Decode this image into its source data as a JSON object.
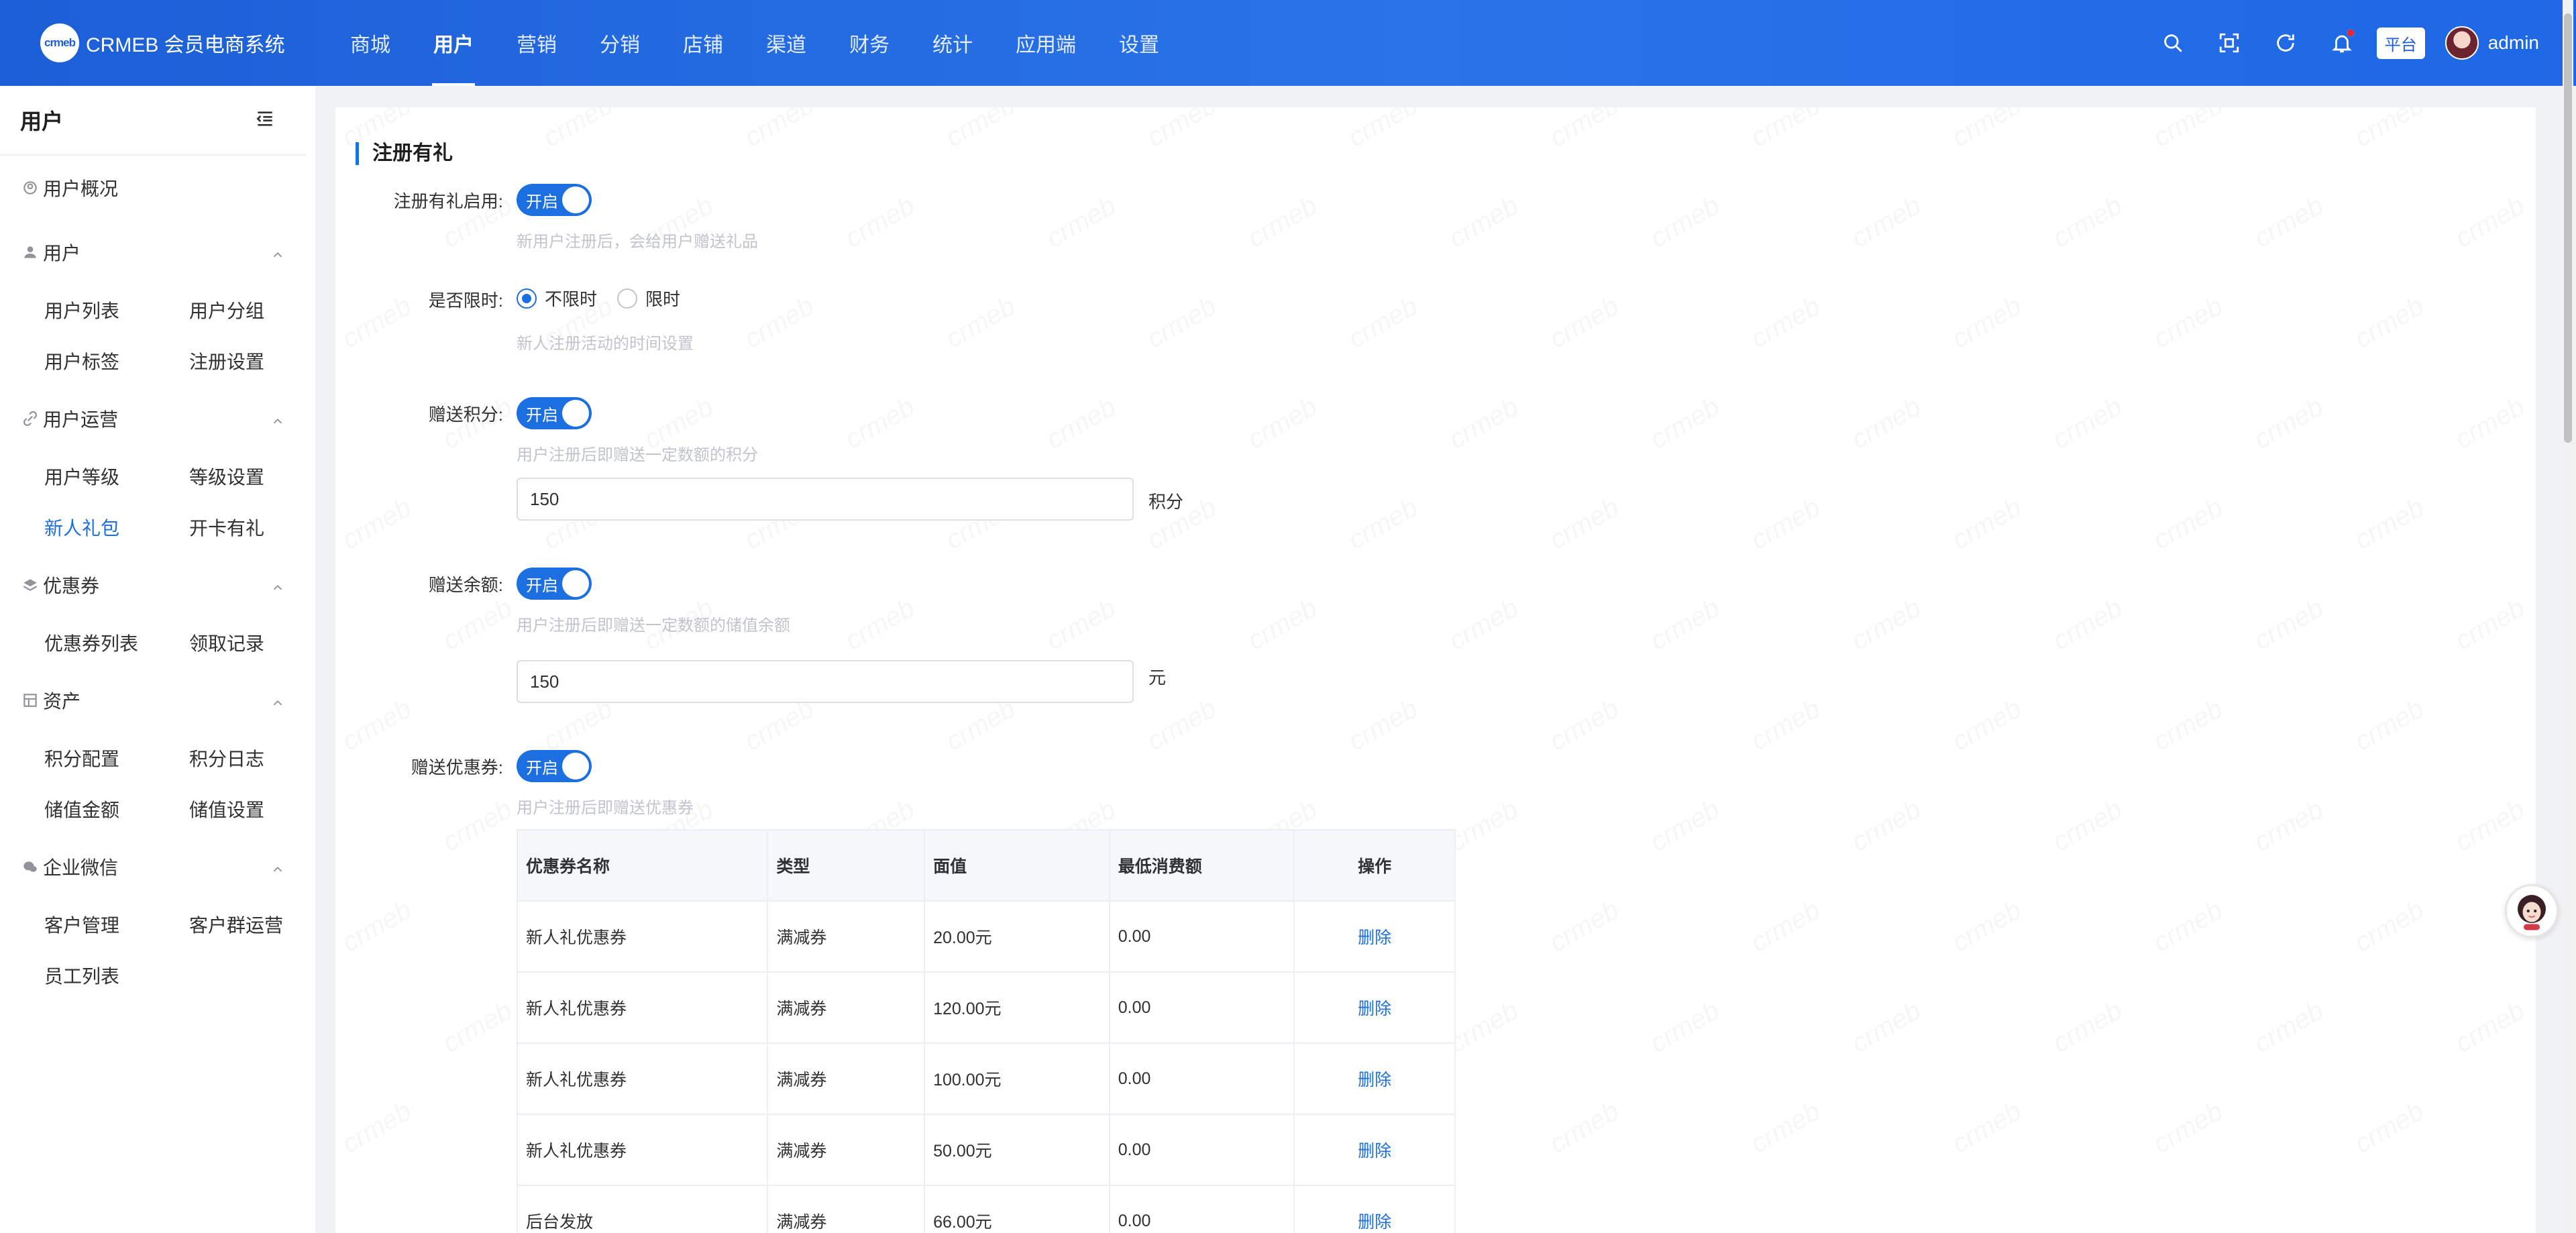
{
  "app": {
    "logo_mark": "crmeb",
    "name": "CRMEB 会员电商系统"
  },
  "nav": {
    "items": [
      "商城",
      "用户",
      "营销",
      "分销",
      "店铺",
      "渠道",
      "财务",
      "统计",
      "应用端",
      "设置"
    ],
    "active": "用户"
  },
  "topbar": {
    "platform_badge": "平台",
    "username": "admin"
  },
  "sidebar": {
    "title": "用户",
    "overview": "用户概况",
    "groups": [
      {
        "label": "用户",
        "items": [
          "用户列表",
          "用户分组",
          "用户标签",
          "注册设置"
        ]
      },
      {
        "label": "用户运营",
        "items": [
          "用户等级",
          "等级设置",
          "新人礼包",
          "开卡有礼"
        ]
      },
      {
        "label": "优惠券",
        "items": [
          "优惠券列表",
          "领取记录"
        ]
      },
      {
        "label": "资产",
        "items": [
          "积分配置",
          "积分日志",
          "储值金额",
          "储值设置"
        ]
      },
      {
        "label": "企业微信",
        "items": [
          "客户管理",
          "客户群运营",
          "员工列表"
        ]
      }
    ],
    "active_item": "新人礼包"
  },
  "form": {
    "section_title": "注册有礼",
    "enable": {
      "label": "注册有礼启用:",
      "switch_text": "开启",
      "hint": "新用户注册后，会给用户赠送礼品"
    },
    "time_limit": {
      "label": "是否限时:",
      "options": [
        "不限时",
        "限时"
      ],
      "selected": "不限时",
      "hint": "新人注册活动的时间设置"
    },
    "points": {
      "label": "赠送积分:",
      "switch_text": "开启",
      "hint": "用户注册后即赠送一定数额的积分",
      "value": "150",
      "unit": "积分"
    },
    "balance": {
      "label": "赠送余额:",
      "switch_text": "开启",
      "hint": "用户注册后即赠送一定数额的储值余额",
      "value": "150",
      "unit": "元"
    },
    "coupon": {
      "label": "赠送优惠券:",
      "switch_text": "开启",
      "hint": "用户注册后即赠送优惠券"
    }
  },
  "coupon_table": {
    "headers": [
      "优惠券名称",
      "类型",
      "面值",
      "最低消费额",
      "操作"
    ],
    "rows": [
      {
        "name": "新人礼优惠券",
        "type": "满减券",
        "face": "20.00元",
        "min": "0.00",
        "action": "删除"
      },
      {
        "name": "新人礼优惠券",
        "type": "满减券",
        "face": "120.00元",
        "min": "0.00",
        "action": "删除"
      },
      {
        "name": "新人礼优惠券",
        "type": "满减券",
        "face": "100.00元",
        "min": "0.00",
        "action": "删除"
      },
      {
        "name": "新人礼优惠券",
        "type": "满减券",
        "face": "50.00元",
        "min": "0.00",
        "action": "删除"
      },
      {
        "name": "后台发放",
        "type": "满减券",
        "face": "66.00元",
        "min": "0.00",
        "action": "删除"
      }
    ]
  },
  "watermark": {
    "text": "crmeb"
  },
  "colors": {
    "primary": "#1c6fe0",
    "topbar": "#2a73e8"
  },
  "icons": [
    "search-icon",
    "fullscreen-icon",
    "refresh-icon",
    "bell-icon",
    "menu-collapse-icon",
    "chevron-up-icon",
    "customer-service-icon"
  ]
}
